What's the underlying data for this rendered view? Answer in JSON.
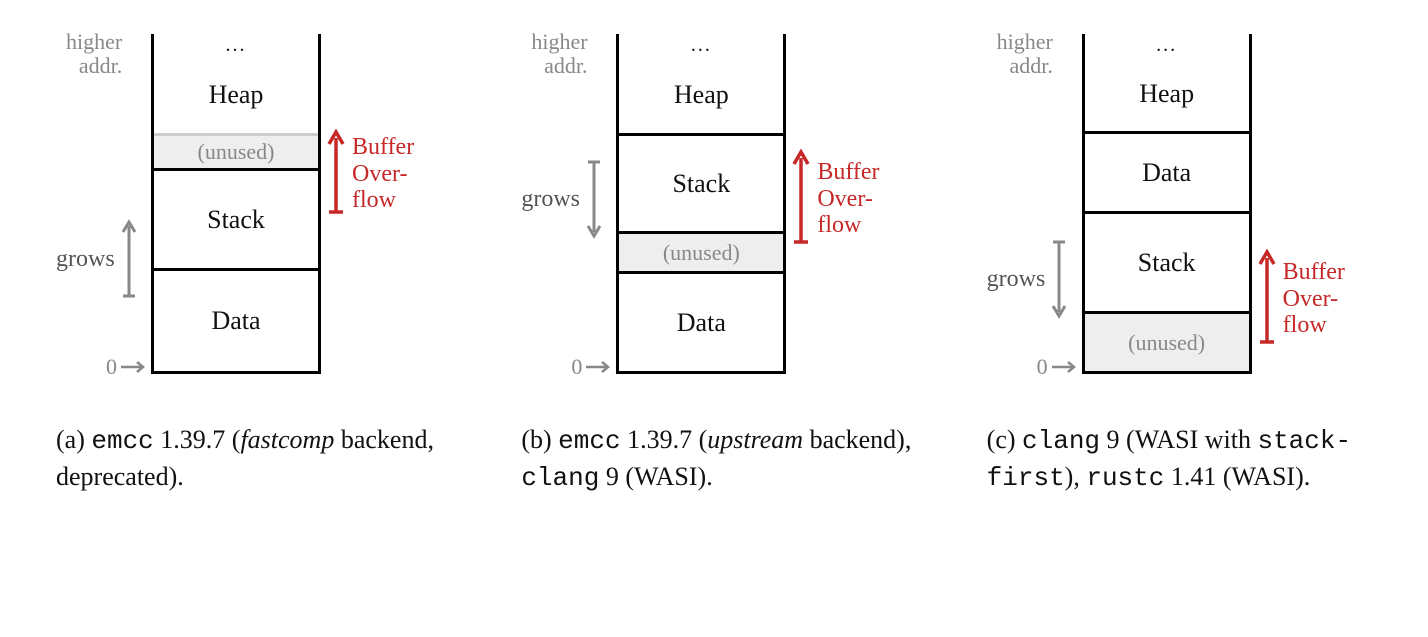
{
  "common": {
    "higher_label_l1": "higher",
    "higher_label_l2": "addr.",
    "zero_label": "0",
    "grows_label": "grows",
    "buffer_l1": "Buffer",
    "buffer_l2": "Over-",
    "buffer_l3": "flow",
    "dots": "...",
    "heap": "Heap",
    "stack": "Stack",
    "data": "Data",
    "unused": "(unused)"
  },
  "panelA": {
    "cap_prefix": "(a) ",
    "cap_mono1": "emcc",
    "cap_after1": " 1.39.7 (",
    "cap_ital": "fastcomp",
    "cap_after2": " backend, deprecated)."
  },
  "panelB": {
    "cap_prefix": "(b) ",
    "cap_mono1": "emcc",
    "cap_after1": " 1.39.7 (",
    "cap_ital": "upstream",
    "cap_after2": " backend), ",
    "cap_mono2": "clang",
    "cap_after3": " 9 (WASI)."
  },
  "panelC": {
    "cap_prefix": "(c) ",
    "cap_mono1": "clang",
    "cap_after1": " 9 (WASI with ",
    "cap_mono2": "stack-first",
    "cap_after2": "), ",
    "cap_mono3": "rustc",
    "cap_after3": " 1.41 (WASI)."
  }
}
